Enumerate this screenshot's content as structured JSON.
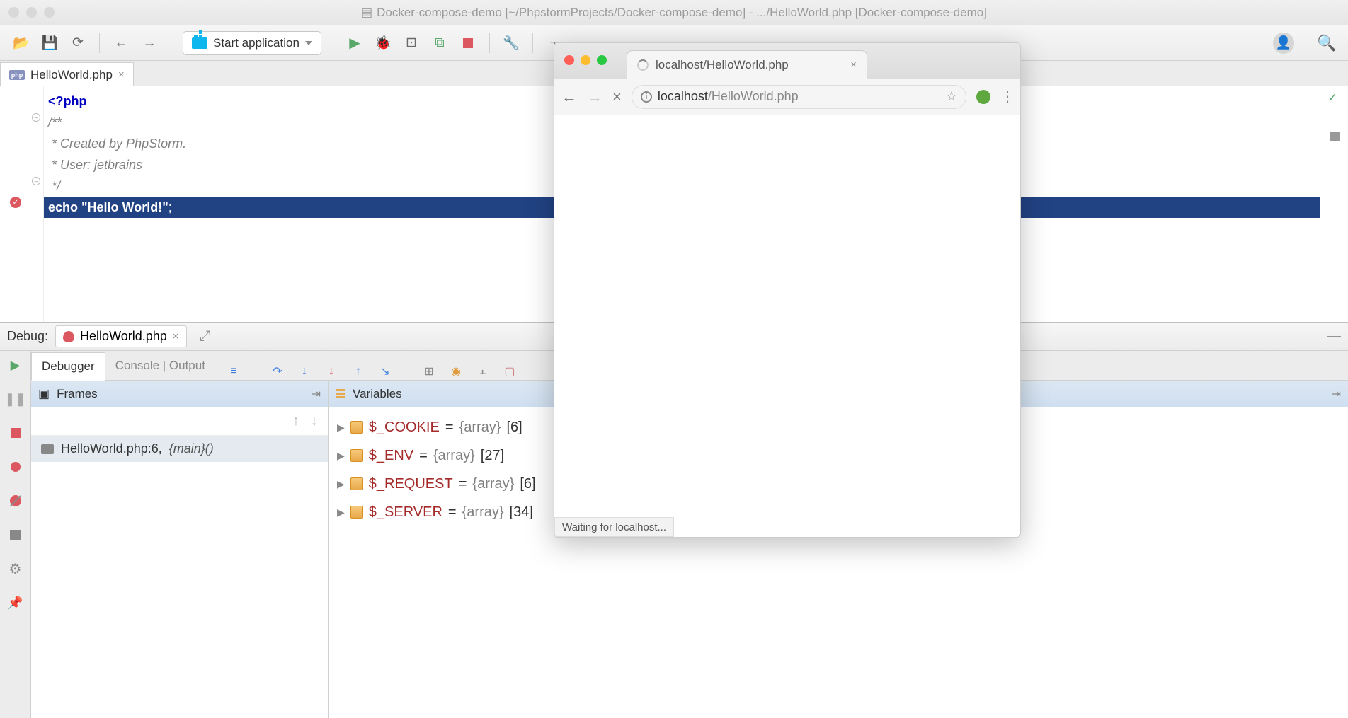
{
  "titlebar": {
    "text": "Docker-compose-demo [~/PhpstormProjects/Docker-compose-demo] - .../HelloWorld.php [Docker-compose-demo]"
  },
  "toolbar": {
    "run_config": "Start application"
  },
  "editor_tab": {
    "filename": "HelloWorld.php"
  },
  "code": {
    "l1": "<?php",
    "l2": "/**",
    "l3": " * Created by PhpStorm.",
    "l4": " * User: jetbrains",
    "l5": " */",
    "l6_kw": "echo ",
    "l6_str": "\"Hello World!\"",
    "l6_end": ";"
  },
  "debug": {
    "label": "Debug:",
    "session": "HelloWorld.php",
    "tabs": {
      "debugger": "Debugger",
      "console_output": "Console | Output"
    },
    "frames_title": "Frames",
    "vars_title": "Variables",
    "frame": {
      "file": "HelloWorld.php:6, ",
      "fn": "{main}()"
    },
    "vars": [
      {
        "name": "$_COOKIE",
        "type": "{array}",
        "count": "[6]"
      },
      {
        "name": "$_ENV",
        "type": "{array}",
        "count": "[27]"
      },
      {
        "name": "$_REQUEST",
        "type": "{array}",
        "count": "[6]"
      },
      {
        "name": "$_SERVER",
        "type": "{array}",
        "count": "[34]"
      }
    ]
  },
  "browser": {
    "tab_title": "localhost/HelloWorld.php",
    "url_host": "localhost",
    "url_path": "/HelloWorld.php",
    "status": "Waiting for localhost..."
  }
}
